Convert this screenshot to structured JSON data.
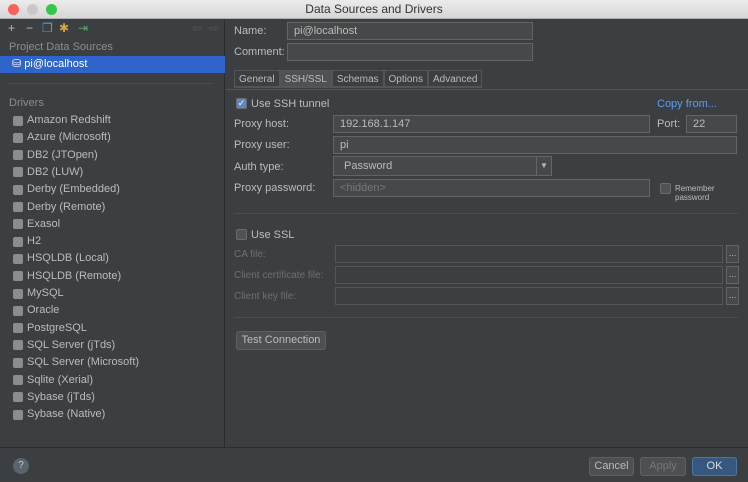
{
  "window": {
    "title": "Data Sources and Drivers"
  },
  "sidebar": {
    "project_header": "Project Data Sources",
    "selected_source": "pi@localhost",
    "drivers_header": "Drivers",
    "drivers": [
      "Amazon Redshift",
      "Azure (Microsoft)",
      "DB2 (JTOpen)",
      "DB2 (LUW)",
      "Derby (Embedded)",
      "Derby (Remote)",
      "Exasol",
      "H2",
      "HSQLDB (Local)",
      "HSQLDB (Remote)",
      "MySQL",
      "Oracle",
      "PostgreSQL",
      "SQL Server (jTds)",
      "SQL Server (Microsoft)",
      "Sqlite (Xerial)",
      "Sybase (jTds)",
      "Sybase (Native)"
    ]
  },
  "form": {
    "name_label": "Name:",
    "name_value": "pi@localhost",
    "comment_label": "Comment:",
    "comment_value": "",
    "tabs": [
      "General",
      "SSH/SSL",
      "Schemas",
      "Options",
      "Advanced"
    ],
    "ssh": {
      "use_label": "Use SSH tunnel",
      "copy_from": "Copy from...",
      "host_label": "Proxy host:",
      "host_value": "192.168.1.147",
      "port_label": "Port:",
      "port_value": "22",
      "user_label": "Proxy user:",
      "user_value": "pi",
      "auth_label": "Auth type:",
      "auth_value": "Password",
      "password_label": "Proxy password:",
      "password_placeholder": "<hidden>",
      "remember_label": "Remember password"
    },
    "ssl": {
      "use_label": "Use SSL",
      "ca_label": "CA file:",
      "cert_label": "Client certificate file:",
      "key_label": "Client key file:",
      "browse": "..."
    },
    "test_button": "Test Connection"
  },
  "footer": {
    "help": "?",
    "cancel": "Cancel",
    "apply": "Apply",
    "ok": "OK"
  }
}
